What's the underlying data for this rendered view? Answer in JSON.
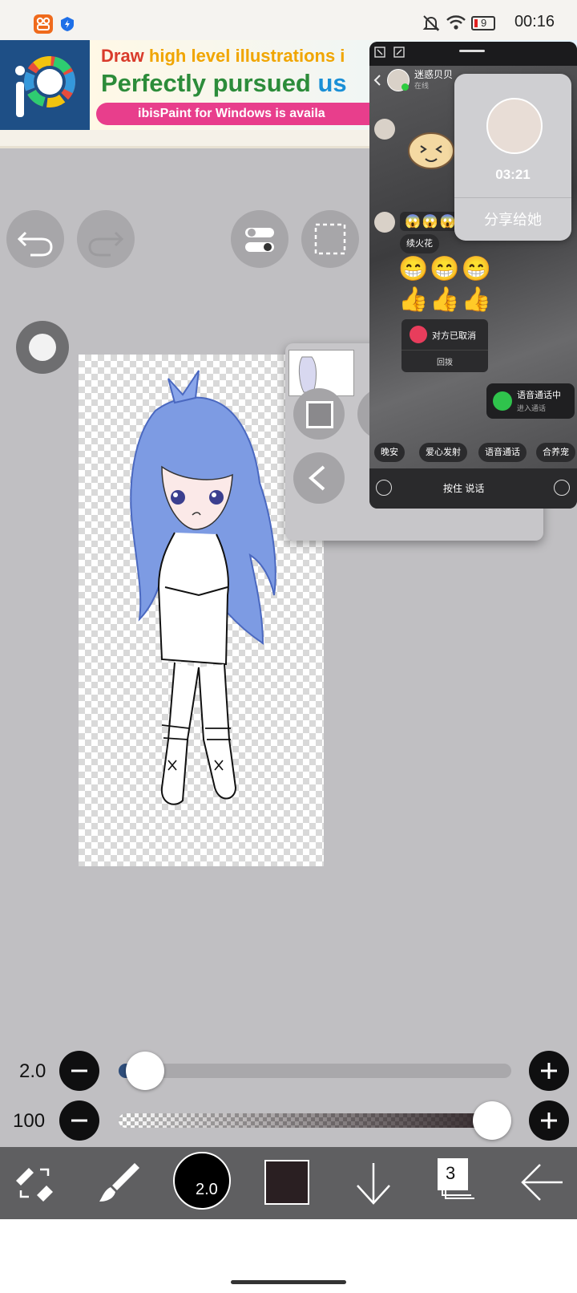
{
  "status_bar": {
    "time": "00:16",
    "battery": "9"
  },
  "ad": {
    "line1_a": "Draw ",
    "line1_b": "high level illustrations i",
    "line2_a": "Perfectly pursued ",
    "line2_b": "us",
    "line3": "ibisPaint for Windows is availa"
  },
  "chat": {
    "contact_name": "迷惑贝贝",
    "online_text": "在线",
    "emoji_big": "😱😱😱😱",
    "fire_tag": "续火花",
    "grin_row": "😁😁😁",
    "thumbs_row": "👍👍👍",
    "cancelled_text": "对方已取消",
    "redial_label": "回拨",
    "voice_call_title": "语音通话中",
    "voice_call_sub": "进入通话",
    "quick_actions": [
      "晚安",
      "爱心发射",
      "语音通话",
      "合养宠"
    ],
    "hold_to_talk": "按住 说话"
  },
  "call_card": {
    "timer": "03:21",
    "share_label": "分享给她"
  },
  "brush_panel": {
    "size_value": "2.0",
    "opacity_value": "100",
    "size_fraction": 0.02,
    "opacity_fraction": 1.0
  },
  "toolbar": {
    "brush_size_display": "2.0",
    "layer_count": "3",
    "current_color": "#2a1f22"
  }
}
